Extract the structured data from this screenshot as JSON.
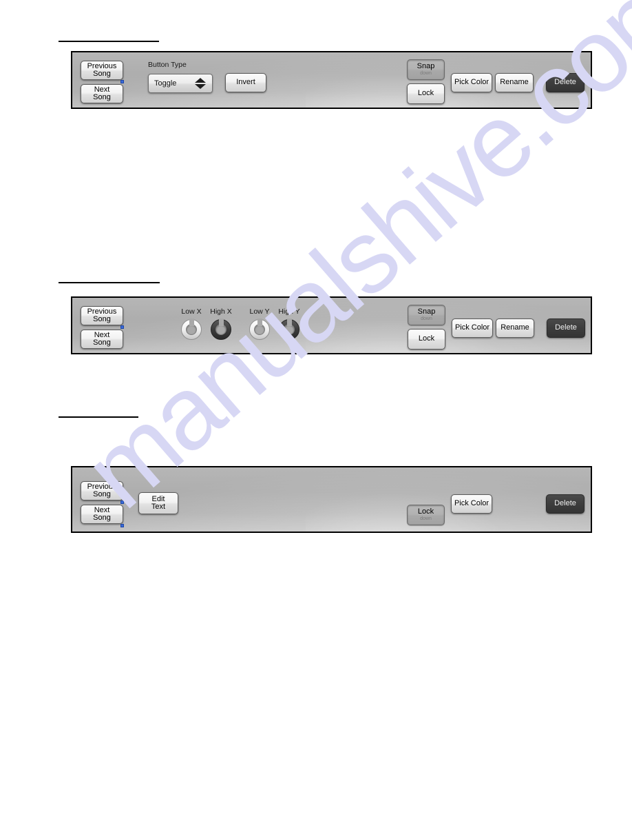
{
  "page": {
    "watermark_text": "manualshive.com",
    "watermark_color": "#d7d7f4",
    "background_color": "#ffffff",
    "panel_color": "#adadad",
    "delete_button_color": "#3d3d3d"
  },
  "panels": [
    {
      "id": "button-properties-panel",
      "nav": {
        "previous_line1": "Previous",
        "previous_line2": "Song",
        "next_line1": "Next",
        "next_line2": "Song"
      },
      "button_type": {
        "label": "Button Type",
        "value": "Toggle"
      },
      "invert_label": "Invert",
      "snap": {
        "label": "Snap",
        "state": "down"
      },
      "lock": {
        "label": "Lock",
        "state": "up"
      },
      "pick_color_label": "Pick Color",
      "rename_label": "Rename",
      "delete_label": "Delete"
    },
    {
      "id": "xy-pad-properties-panel",
      "nav": {
        "previous_line1": "Previous",
        "previous_line2": "Song",
        "next_line1": "Next",
        "next_line2": "Song"
      },
      "knobs": [
        {
          "label": "Low X",
          "style": "light"
        },
        {
          "label": "High X",
          "style": "dark"
        },
        {
          "label": "Low Y",
          "style": "light"
        },
        {
          "label": "High Y",
          "style": "dark"
        }
      ],
      "snap": {
        "label": "Snap",
        "state": "down"
      },
      "lock": {
        "label": "Lock",
        "state": "up"
      },
      "pick_color_label": "Pick Color",
      "rename_label": "Rename",
      "delete_label": "Delete"
    },
    {
      "id": "text-label-properties-panel",
      "nav": {
        "previous_line1": "Previous",
        "previous_line2": "Song",
        "next_line1": "Next",
        "next_line2": "Song"
      },
      "edit_text_line1": "Edit",
      "edit_text_line2": "Text",
      "lock": {
        "label": "Lock",
        "state": "down"
      },
      "pick_color_label": "Pick Color",
      "delete_label": "Delete"
    }
  ],
  "common": {
    "down_sub_label": "down"
  }
}
